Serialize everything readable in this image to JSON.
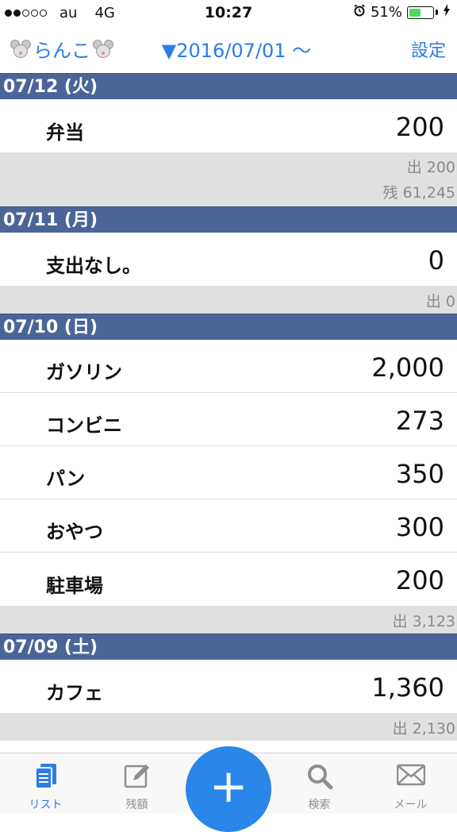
{
  "status_bar": {
    "carrier": "au",
    "network": "4G",
    "time": "10:27",
    "battery": "51%",
    "battery_level": 0.51
  },
  "nav": {
    "title": "らんこ",
    "period": "▼2016/07/01 ～",
    "settings_label": "設定"
  },
  "days": [
    {
      "date": "07/12 (火)",
      "items": [
        {
          "name": "弁当",
          "amount": "200"
        }
      ],
      "summary": [
        "出 200",
        "残 61,245"
      ]
    },
    {
      "date": "07/11 (月)",
      "items": [
        {
          "name": "支出なし。",
          "amount": "0"
        }
      ],
      "summary": [
        "出 0"
      ]
    },
    {
      "date": "07/10 (日)",
      "items": [
        {
          "name": "ガソリン",
          "amount": "2,000"
        },
        {
          "name": "コンビニ",
          "amount": "273"
        },
        {
          "name": "パン",
          "amount": "350"
        },
        {
          "name": "おやつ",
          "amount": "300"
        },
        {
          "name": "駐車場",
          "amount": "200"
        }
      ],
      "summary": [
        "出 3,123"
      ]
    },
    {
      "date": "07/09 (土)",
      "items": [
        {
          "name": "カフェ",
          "amount": "1,360"
        }
      ],
      "summary": [
        "出 2,130"
      ]
    }
  ],
  "tabs": [
    {
      "label": "リスト",
      "icon": "document-list-icon",
      "active": true
    },
    {
      "label": "残額",
      "icon": "edit-icon",
      "active": false
    },
    {
      "label": "検索",
      "icon": "search-icon",
      "active": false
    },
    {
      "label": "メール",
      "icon": "mail-icon",
      "active": false
    }
  ],
  "add_button": "+",
  "colors": {
    "accent": "#2b7de9",
    "header_bg": "#4a6598",
    "summary_bg": "#e0e0e0",
    "battery": "#4cd964"
  }
}
